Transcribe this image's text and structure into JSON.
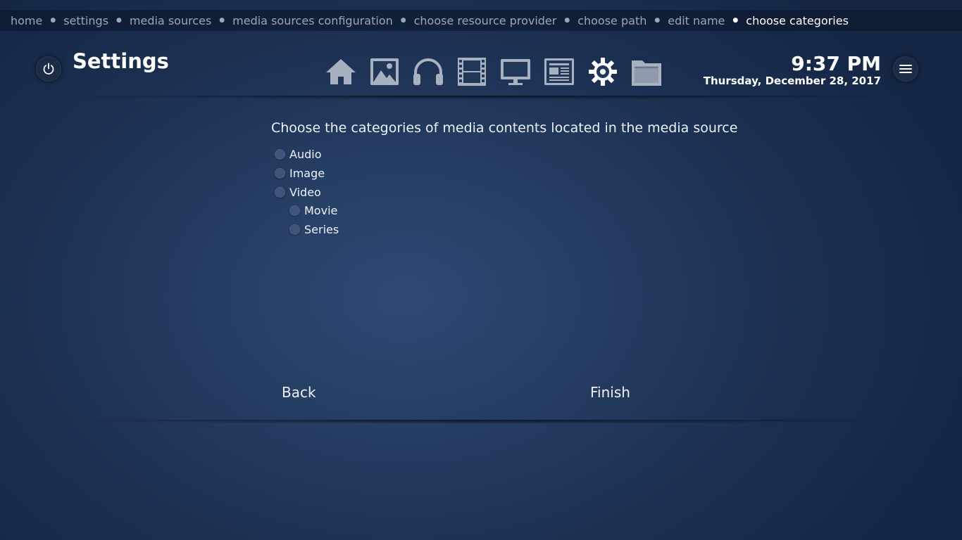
{
  "breadcrumb": [
    {
      "label": "home",
      "current": false
    },
    {
      "label": "settings",
      "current": false
    },
    {
      "label": "media sources",
      "current": false
    },
    {
      "label": "media sources configuration",
      "current": false
    },
    {
      "label": "choose resource provider",
      "current": false
    },
    {
      "label": "choose path",
      "current": false
    },
    {
      "label": "edit name",
      "current": false
    },
    {
      "label": "choose categories",
      "current": true
    }
  ],
  "header": {
    "title": "Settings",
    "time": "9:37 PM",
    "date": "Thursday, December 28, 2017",
    "nav_icons": [
      "home-icon",
      "image-icon",
      "headphones-icon",
      "film-icon",
      "monitor-icon",
      "news-icon",
      "gear-icon",
      "folder-icon"
    ],
    "active_icon": "gear-icon"
  },
  "main": {
    "prompt": "Choose the categories of media contents located in the media source",
    "categories": [
      {
        "label": "Audio",
        "level": 0,
        "checked": false
      },
      {
        "label": "Image",
        "level": 0,
        "checked": false
      },
      {
        "label": "Video",
        "level": 0,
        "checked": false
      },
      {
        "label": "Movie",
        "level": 1,
        "checked": false
      },
      {
        "label": "Series",
        "level": 1,
        "checked": false
      }
    ]
  },
  "footer": {
    "back_label": "Back",
    "finish_label": "Finish"
  },
  "colors": {
    "icon_inactive": "#a7b1c0",
    "icon_active": "#ffffff",
    "radio": "#3f5478"
  }
}
